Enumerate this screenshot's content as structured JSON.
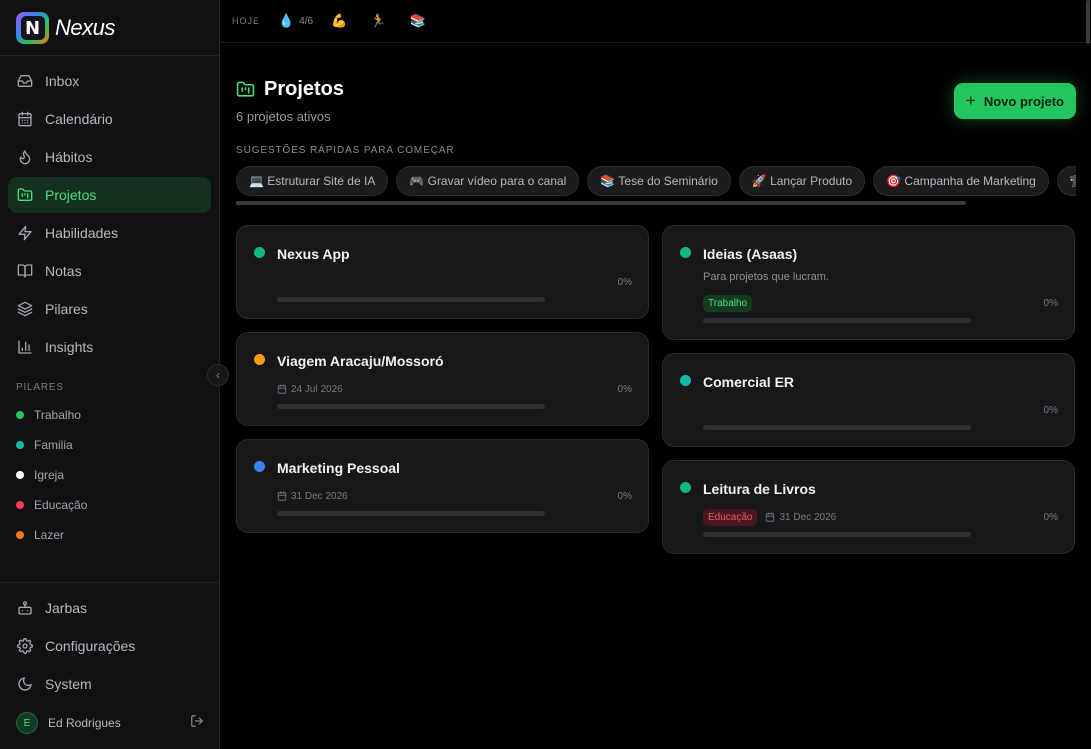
{
  "brand": {
    "name": "Nexus",
    "logo_letter": "N"
  },
  "nav": [
    {
      "label": "Inbox",
      "icon": "inbox-icon"
    },
    {
      "label": "Calendário",
      "icon": "calendar-icon"
    },
    {
      "label": "Hábitos",
      "icon": "flame-icon"
    },
    {
      "label": "Projetos",
      "icon": "folder-kanban-icon",
      "active": true
    },
    {
      "label": "Habilidades",
      "icon": "zap-icon"
    },
    {
      "label": "Notas",
      "icon": "book-open-icon"
    },
    {
      "label": "Pilares",
      "icon": "layers-icon"
    },
    {
      "label": "Insights",
      "icon": "bar-chart-icon"
    }
  ],
  "pillars_title": "PILARES",
  "pillars": [
    {
      "label": "Trabalho",
      "color": "#22c55e"
    },
    {
      "label": "Familia",
      "color": "#14b8a6"
    },
    {
      "label": "Igreja",
      "color": "#ffffff"
    },
    {
      "label": "Educação",
      "color": "#f43f5e"
    },
    {
      "label": "Lazer",
      "color": "#f97316"
    }
  ],
  "bottom_nav": [
    {
      "label": "Jarbas",
      "icon": "bot-icon"
    },
    {
      "label": "Configurações",
      "icon": "settings-icon"
    },
    {
      "label": "System",
      "icon": "moon-icon"
    }
  ],
  "user": {
    "initial": "E",
    "name": "Ed Rodrigues"
  },
  "topbar": {
    "today": "HOJE",
    "habits": [
      {
        "emoji": "💧",
        "count": "4/6"
      },
      {
        "emoji": "💪",
        "count": ""
      },
      {
        "emoji": "🏃",
        "count": ""
      },
      {
        "emoji": "📚",
        "count": ""
      }
    ]
  },
  "page": {
    "title": "Projetos",
    "subtitle": "6 projetos ativos",
    "new_button": "Novo projeto",
    "suggestions_title": "SUGESTÕES RÁPIDAS PARA COMEÇAR",
    "suggestions": [
      "💻 Estruturar Site de IA",
      "🎮 Gravar vídeo para o canal",
      "📚 Tese do Seminário",
      "🚀 Lançar Produto",
      "🎯 Campanha de Marketing",
      "🏗"
    ]
  },
  "projects": {
    "left": [
      {
        "title": "Nexus App",
        "color": "#10b981",
        "description": "",
        "tag": "",
        "tag_class": "",
        "date": "",
        "progress": "0%"
      },
      {
        "title": "Viagem Aracaju/Mossoró",
        "color": "#f59e0b",
        "description": "",
        "tag": "",
        "tag_class": "",
        "date": "24 Jul 2026",
        "progress": "0%"
      },
      {
        "title": "Marketing Pessoal",
        "color": "#3b82f6",
        "description": "",
        "tag": "",
        "tag_class": "",
        "date": "31 Dec 2026",
        "progress": "0%"
      }
    ],
    "right": [
      {
        "title": "Ideias (Asaas)",
        "color": "#10b981",
        "description": "Para projetos que lucram.",
        "tag": "Trabalho",
        "tag_class": "trabalho",
        "date": "",
        "progress": "0%"
      },
      {
        "title": "Comercial ER",
        "color": "#14b8a6",
        "description": "",
        "tag": "",
        "tag_class": "",
        "date": "",
        "progress": "0%"
      },
      {
        "title": "Leitura de Livros",
        "color": "#10b981",
        "description": "",
        "tag": "Educação",
        "tag_class": "educacao",
        "date": "31 Dec 2026",
        "progress": "0%"
      }
    ]
  }
}
